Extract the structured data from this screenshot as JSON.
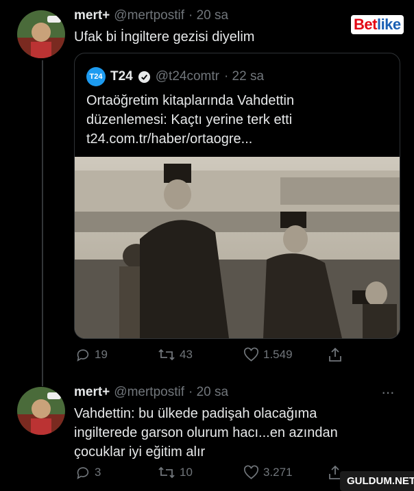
{
  "tweet1": {
    "name": "mert+",
    "handle": "@mertpostif",
    "time": "· 20 sa",
    "text": "Ufak bi İngiltere gezisi diyelim"
  },
  "brand_logo": {
    "part1": "Bet",
    "part2": "like"
  },
  "quote": {
    "badge": "T24",
    "name": "T24",
    "handle": "@t24comtr",
    "time": "· 22 sa",
    "text": "Ortaöğretim kitaplarında Vahdettin düzenlemesi: Kaçtı yerine terk etti t24.com.tr/haber/ortaogre..."
  },
  "actions1": {
    "replies": "19",
    "retweets": "43",
    "likes": "1.549"
  },
  "tweet2": {
    "name": "mert+",
    "handle": "@mertpostif",
    "time": "· 20 sa",
    "more": "···",
    "text_lines": [
      "Vahdettin: bu ülkede padişah olacağıma",
      "ingilterede garson olurum hacı...en azından",
      "çocuklar iyi eğitim alır"
    ]
  },
  "actions2": {
    "replies": "3",
    "retweets": "10",
    "likes": "3.271"
  },
  "watermark": "GULDUM.NET",
  "colors": {
    "background": "#000000",
    "muted": "#71767b",
    "verified": "#1d9bf0",
    "border": "#2f3336"
  },
  "icons": [
    "reply-icon",
    "retweet-icon",
    "like-icon",
    "share-icon",
    "verified-badge-icon",
    "more-options-icon"
  ]
}
